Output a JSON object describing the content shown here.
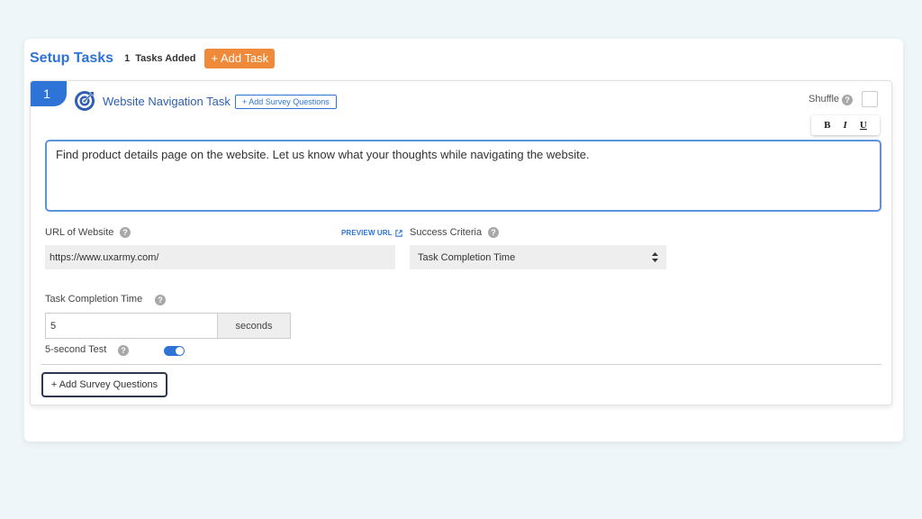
{
  "header": {
    "title": "Setup Tasks",
    "task_count": "1",
    "task_count_label": "Tasks Added",
    "add_task_label": "+ Add Task"
  },
  "task": {
    "number": "1",
    "icon": "target-icon",
    "title": "Website Navigation Task",
    "add_survey_small_label": "+ Add Survey Questions",
    "shuffle_label": "Shuffle",
    "shuffle_checked": false,
    "toolbar": {
      "bold": "B",
      "italic": "I",
      "underline": "U"
    },
    "description": "Find product details page on the website. Let us know what your thoughts while navigating the website.",
    "url_label": "URL of Website",
    "preview_url_label": "PREVIEW URL",
    "url_value": "https://www.uxarmy.com/",
    "criteria_label": "Success Criteria",
    "criteria_value": "Task Completion Time",
    "completion_label": "Task Completion Time",
    "completion_value": "5",
    "completion_unit": "seconds",
    "five_second_label": "5-second Test",
    "five_second_enabled": true,
    "add_survey_button_label": "+ Add Survey Questions"
  },
  "help_glyph": "?",
  "colors": {
    "accent": "#2e73d6",
    "add_task": "#ee8a3a",
    "background": "#eef6f9"
  }
}
